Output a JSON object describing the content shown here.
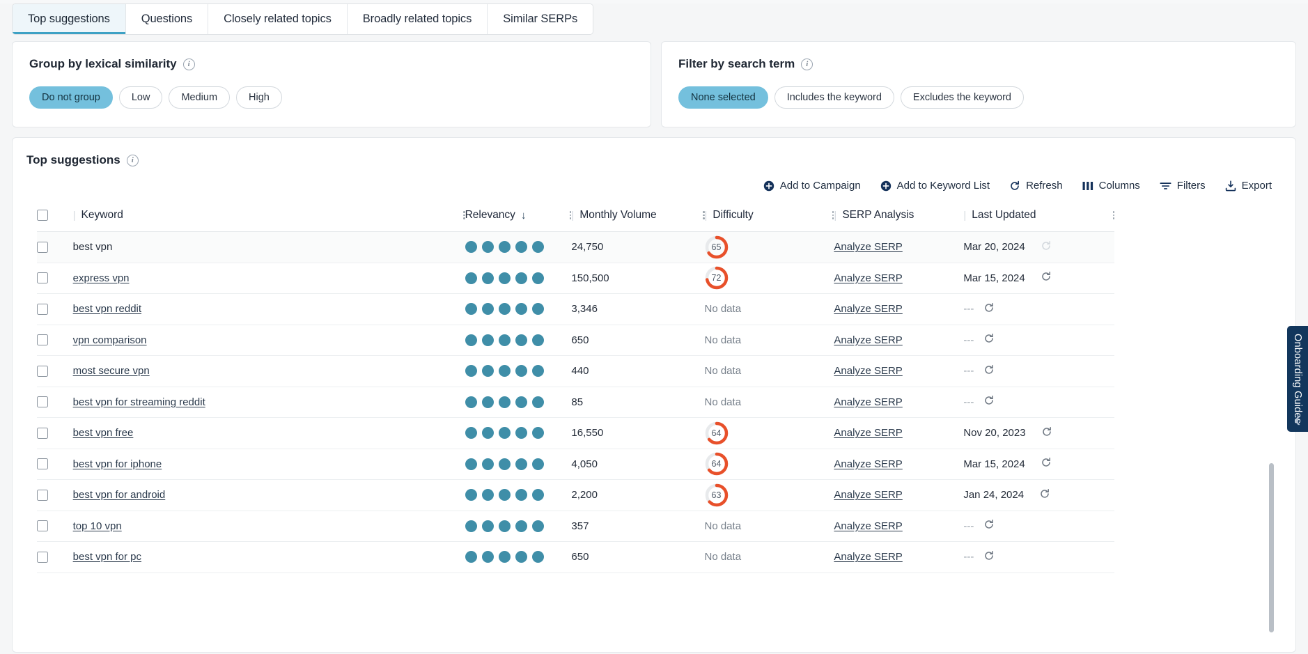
{
  "tabs": [
    {
      "label": "Top suggestions",
      "active": true
    },
    {
      "label": "Questions",
      "active": false
    },
    {
      "label": "Closely related topics",
      "active": false
    },
    {
      "label": "Broadly related topics",
      "active": false
    },
    {
      "label": "Similar SERPs",
      "active": false
    }
  ],
  "group_card": {
    "title": "Group by lexical similarity",
    "info": "i",
    "options": [
      {
        "label": "Do not group",
        "selected": true
      },
      {
        "label": "Low",
        "selected": false
      },
      {
        "label": "Medium",
        "selected": false
      },
      {
        "label": "High",
        "selected": false
      }
    ]
  },
  "filter_card": {
    "title": "Filter by search term",
    "info": "i",
    "options": [
      {
        "label": "None selected",
        "selected": true
      },
      {
        "label": "Includes the keyword",
        "selected": false
      },
      {
        "label": "Excludes the keyword",
        "selected": false
      }
    ]
  },
  "panel": {
    "title": "Top suggestions",
    "info": "i"
  },
  "toolbar": [
    {
      "label": "Add to Campaign",
      "icon": "plus-circle-icon"
    },
    {
      "label": "Add to Keyword List",
      "icon": "plus-circle-icon"
    },
    {
      "label": "Refresh",
      "icon": "refresh-icon"
    },
    {
      "label": "Columns",
      "icon": "columns-icon"
    },
    {
      "label": "Filters",
      "icon": "filter-icon"
    },
    {
      "label": "Export",
      "icon": "export-icon"
    }
  ],
  "table": {
    "columns": [
      {
        "label": "Keyword",
        "sorted": false
      },
      {
        "label": "Relevancy",
        "sorted": true,
        "sort_dir": "↓"
      },
      {
        "label": "Monthly Volume",
        "sorted": false
      },
      {
        "label": "Difficulty",
        "sorted": false
      },
      {
        "label": "SERP Analysis",
        "sorted": false
      },
      {
        "label": "Last Updated",
        "sorted": false
      }
    ],
    "serp_link_label": "Analyze SERP",
    "no_data_label": "No data",
    "empty_date_label": "---",
    "rows": [
      {
        "keyword": "best vpn",
        "is_link": false,
        "relevancy": 5,
        "volume": "24,750",
        "difficulty": "65",
        "serp": "Analyze SERP",
        "updated": "Mar 20, 2024",
        "refresh_dim": true
      },
      {
        "keyword": "express vpn",
        "is_link": true,
        "relevancy": 5,
        "volume": "150,500",
        "difficulty": "72",
        "serp": "Analyze SERP",
        "updated": "Mar 15, 2024",
        "refresh_dim": false
      },
      {
        "keyword": "best vpn reddit",
        "is_link": true,
        "relevancy": 5,
        "volume": "3,346",
        "difficulty": null,
        "serp": "Analyze SERP",
        "updated": "---",
        "refresh_dim": false
      },
      {
        "keyword": "vpn comparison",
        "is_link": true,
        "relevancy": 5,
        "volume": "650",
        "difficulty": null,
        "serp": "Analyze SERP",
        "updated": "---",
        "refresh_dim": false
      },
      {
        "keyword": "most secure vpn",
        "is_link": true,
        "relevancy": 5,
        "volume": "440",
        "difficulty": null,
        "serp": "Analyze SERP",
        "updated": "---",
        "refresh_dim": false
      },
      {
        "keyword": "best vpn for streaming reddit",
        "is_link": true,
        "relevancy": 5,
        "volume": "85",
        "difficulty": null,
        "serp": "Analyze SERP",
        "updated": "---",
        "refresh_dim": false
      },
      {
        "keyword": "best vpn free",
        "is_link": true,
        "relevancy": 5,
        "volume": "16,550",
        "difficulty": "64",
        "serp": "Analyze SERP",
        "updated": "Nov 20, 2023",
        "refresh_dim": false
      },
      {
        "keyword": "best vpn for iphone",
        "is_link": true,
        "relevancy": 5,
        "volume": "4,050",
        "difficulty": "64",
        "serp": "Analyze SERP",
        "updated": "Mar 15, 2024",
        "refresh_dim": false
      },
      {
        "keyword": "best vpn for android",
        "is_link": true,
        "relevancy": 5,
        "volume": "2,200",
        "difficulty": "63",
        "serp": "Analyze SERP",
        "updated": "Jan 24, 2024",
        "refresh_dim": false
      },
      {
        "keyword": "top 10 vpn",
        "is_link": true,
        "relevancy": 5,
        "volume": "357",
        "difficulty": null,
        "serp": "Analyze SERP",
        "updated": "---",
        "refresh_dim": false
      },
      {
        "keyword": "best vpn for pc",
        "is_link": true,
        "relevancy": 5,
        "volume": "650",
        "difficulty": null,
        "serp": "Analyze SERP",
        "updated": "---",
        "refresh_dim": false
      }
    ]
  },
  "guides": {
    "label": "Onboarding Guides",
    "chevron": "❮"
  },
  "colors": {
    "accent": "#74c0dd",
    "dot": "#3f8ea8",
    "difficulty": "#e8502a",
    "difficulty_track": "#e8eaec",
    "guides_bg": "#12365c",
    "tab_active_bg": "#eef6fa",
    "tab_active_underline": "#3ea1c4"
  }
}
